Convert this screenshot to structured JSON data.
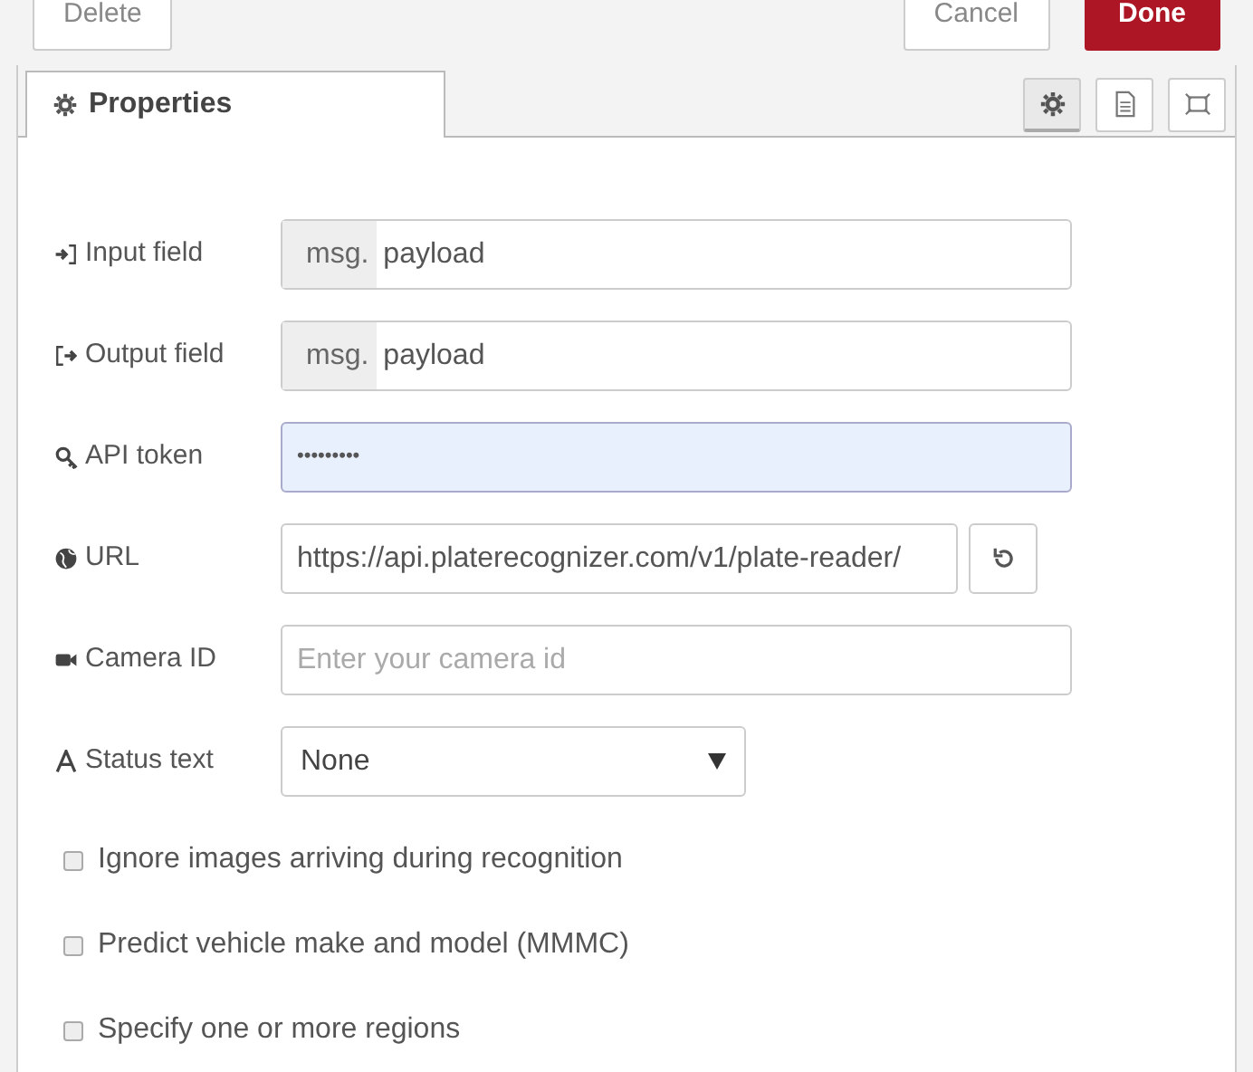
{
  "toolbar": {
    "buttons": [
      {
        "label": "Delete",
        "kind": "plain"
      },
      {
        "label": "Cancel",
        "kind": "plain"
      },
      {
        "label": "Done",
        "kind": "primary"
      }
    ]
  },
  "tabs": [
    {
      "label": "Properties",
      "selected": true
    }
  ],
  "tab_tools": [
    {
      "selected": true
    },
    {
      "selected": false
    },
    {
      "selected": false
    }
  ],
  "fields": [
    {
      "kind": "typed",
      "label": "Input field",
      "prefix": "msg.",
      "value": "payload"
    },
    {
      "kind": "typed",
      "label": "Output field",
      "prefix": "msg.",
      "value": "payload"
    },
    {
      "kind": "password",
      "label": "API token",
      "value": "•••••••••",
      "focused": true
    },
    {
      "kind": "url",
      "label": "URL",
      "value": "https://api.platerecognizer.com/v1/plate-reader/"
    },
    {
      "kind": "text",
      "label": "Camera ID",
      "placeholder": "Enter your camera id"
    },
    {
      "kind": "select",
      "label": "Status text",
      "value": "None"
    }
  ],
  "options": [
    {
      "label": "Ignore images arriving during recognition",
      "checked": false
    },
    {
      "label": "Predict vehicle make and model (MMMC)",
      "checked": false
    },
    {
      "label": "Specify one or more regions",
      "checked": false
    }
  ]
}
